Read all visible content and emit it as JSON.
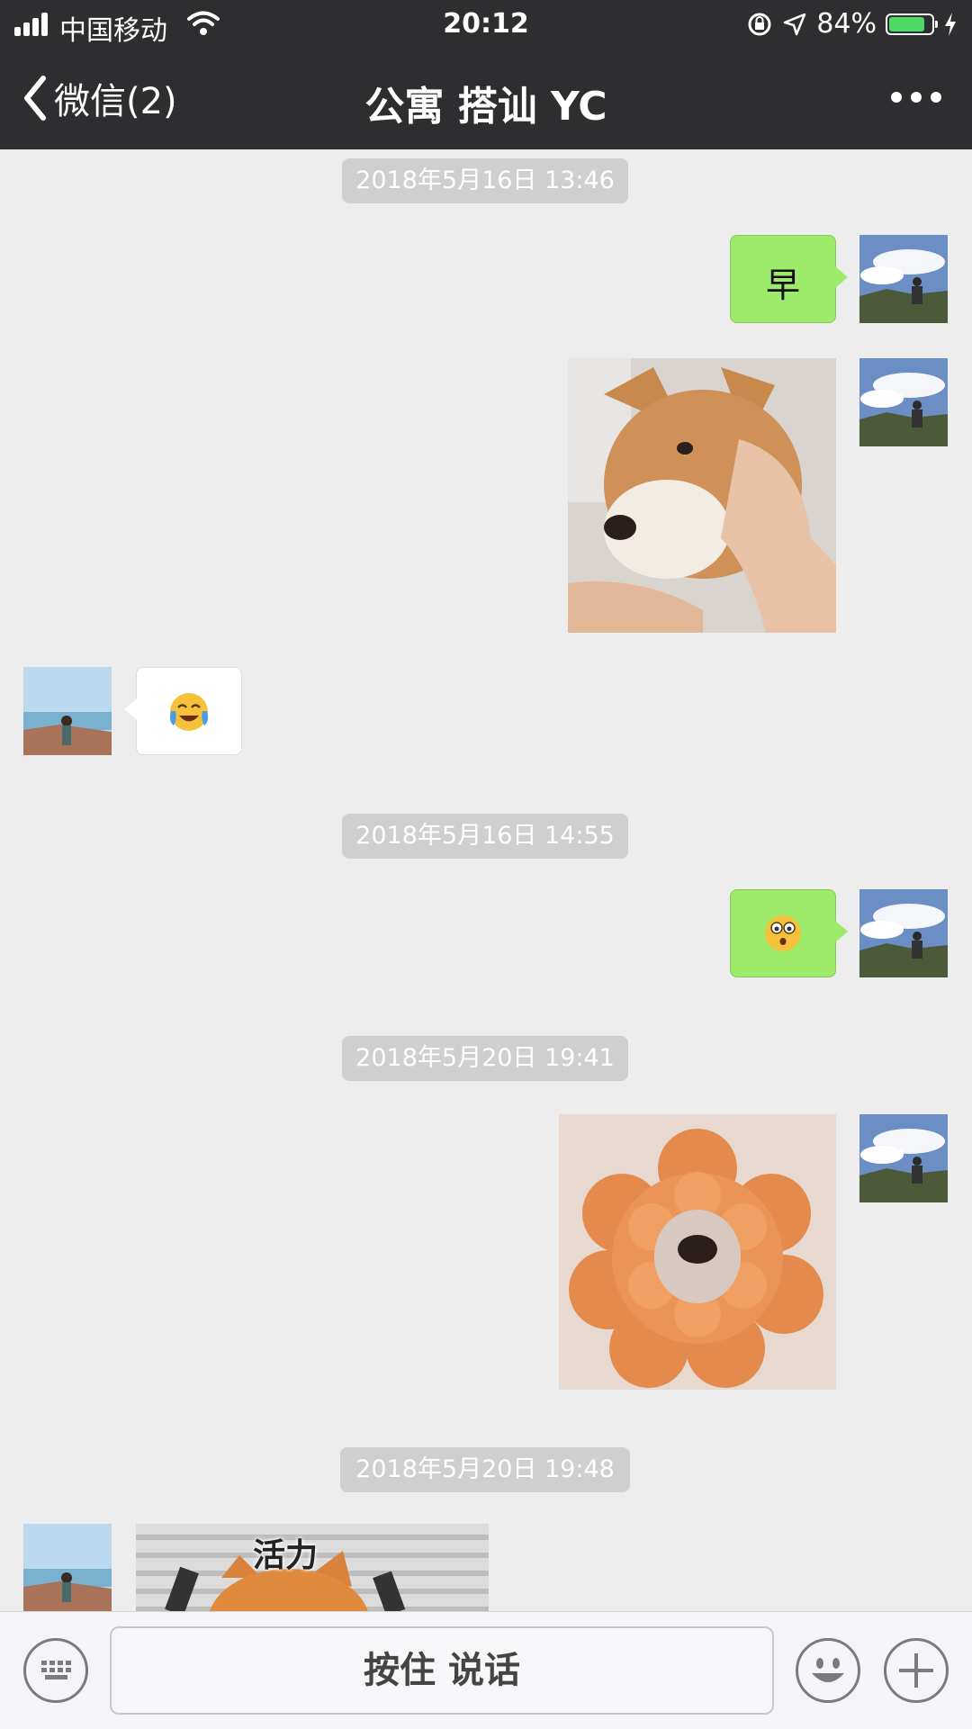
{
  "status_bar": {
    "carrier": "中国移动",
    "time": "20:12",
    "battery_text": "84%",
    "battery_level": 0.84
  },
  "nav": {
    "back_label": "微信(2)",
    "title": "公寓 搭讪 YC"
  },
  "timestamps": [
    "2018年5月16日 13:46",
    "2018年5月16日 14:55",
    "2018年5月20日 19:41",
    "2018年5月20日 19:48"
  ],
  "messages": {
    "text_1": "早"
  },
  "sticker_text": "活力",
  "input": {
    "talk_label": "按住 说话"
  },
  "colors": {
    "nav_bg": "#2e2e30",
    "chat_bg": "#ededed",
    "sent_bubble": "#9eea6a",
    "battery_fill": "#4cd964"
  },
  "icons": [
    "back-chevron-icon",
    "more-dots-icon",
    "keyboard-icon",
    "emoji-icon",
    "plus-icon",
    "wifi-icon",
    "signal-icon",
    "battery-icon",
    "location-icon",
    "orientation-lock-icon",
    "charging-icon"
  ]
}
